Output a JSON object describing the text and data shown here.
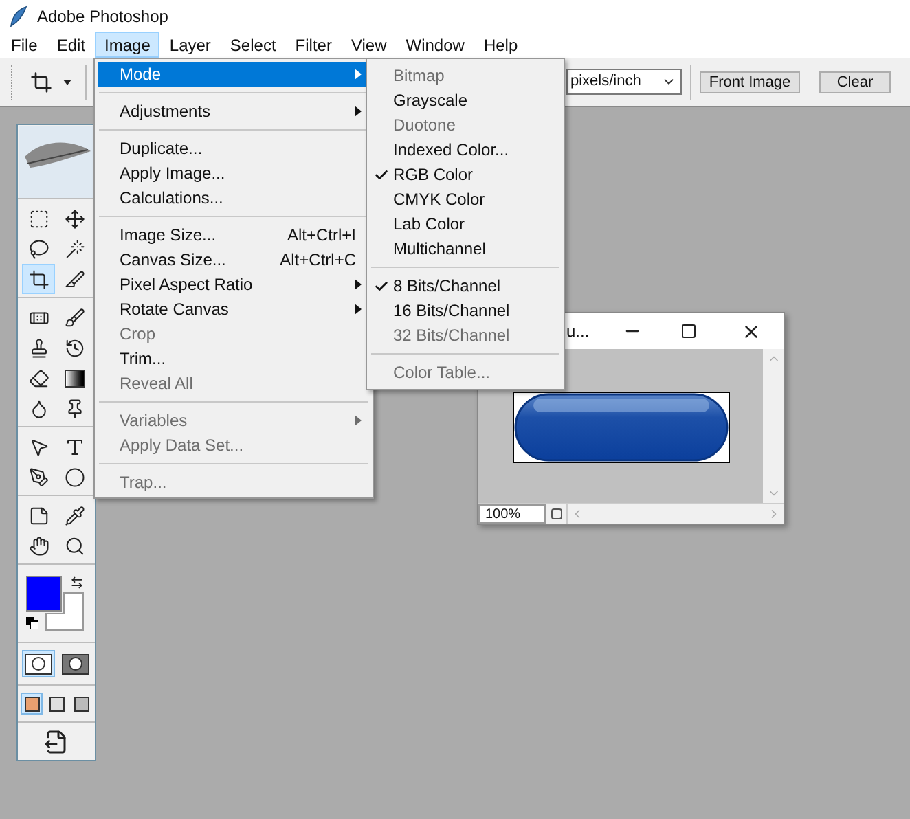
{
  "title_bar": {
    "title": "Adobe Photoshop"
  },
  "menu_bar": [
    {
      "label": "File",
      "selected": false
    },
    {
      "label": "Edit",
      "selected": false
    },
    {
      "label": "Image",
      "selected": true
    },
    {
      "label": "Layer",
      "selected": false
    },
    {
      "label": "Select",
      "selected": false
    },
    {
      "label": "Filter",
      "selected": false
    },
    {
      "label": "View",
      "selected": false
    },
    {
      "label": "Window",
      "selected": false
    },
    {
      "label": "Help",
      "selected": false
    }
  ],
  "options_bar": {
    "resolution_unit": "pixels/inch",
    "buttons": [
      "Front Image",
      "Clear"
    ]
  },
  "toolbox": {
    "tool_groups": [
      [
        {
          "kind": "marquee",
          "selected": false
        },
        {
          "kind": "move",
          "selected": false
        },
        {
          "kind": "lasso",
          "selected": false
        },
        {
          "kind": "wand",
          "selected": false
        },
        {
          "kind": "crop",
          "selected": true
        },
        {
          "kind": "slice",
          "selected": false
        }
      ],
      [
        {
          "kind": "heal",
          "selected": false
        },
        {
          "kind": "brush",
          "selected": false
        },
        {
          "kind": "stamp",
          "selected": false
        },
        {
          "kind": "history",
          "selected": false
        },
        {
          "kind": "eraser",
          "selected": false
        },
        {
          "kind": "gradient",
          "selected": false
        },
        {
          "kind": "blur",
          "selected": false
        },
        {
          "kind": "dodge",
          "selected": false
        }
      ],
      [
        {
          "kind": "path_select",
          "selected": false
        },
        {
          "kind": "type",
          "selected": false
        },
        {
          "kind": "pen",
          "selected": false
        },
        {
          "kind": "ellipse",
          "selected": false
        }
      ],
      [
        {
          "kind": "notes",
          "selected": false
        },
        {
          "kind": "eyedropper",
          "selected": false
        },
        {
          "kind": "hand",
          "selected": false
        },
        {
          "kind": "zoom",
          "selected": false
        }
      ]
    ],
    "foreground": {
      "color": "#0000ff"
    },
    "background": {
      "color": "#ffffff"
    },
    "edit_modes": [
      {
        "kind": "standard",
        "selected": true
      },
      {
        "kind": "quick_mask",
        "selected": false
      }
    ],
    "screen_modes": [
      {
        "kind": "standard",
        "selected": true
      },
      {
        "kind": "full_menu",
        "selected": false
      },
      {
        "kind": "full",
        "selected": false
      }
    ]
  },
  "image_menu": {
    "items": [
      {
        "kind": "item",
        "label": "Mode",
        "submenu": true,
        "disabled": false,
        "selected": true
      },
      {
        "kind": "separator"
      },
      {
        "kind": "item",
        "label": "Adjustments",
        "submenu": true,
        "disabled": false,
        "selected": false
      },
      {
        "kind": "separator"
      },
      {
        "kind": "item",
        "label": "Duplicate...",
        "disabled": false,
        "selected": false
      },
      {
        "kind": "item",
        "label": "Apply Image...",
        "disabled": false,
        "selected": false
      },
      {
        "kind": "item",
        "label": "Calculations...",
        "disabled": false,
        "selected": false
      },
      {
        "kind": "separator"
      },
      {
        "kind": "item",
        "label": "Image Size...",
        "shortcut": "Alt+Ctrl+I",
        "disabled": false,
        "selected": false
      },
      {
        "kind": "item",
        "label": "Canvas Size...",
        "shortcut": "Alt+Ctrl+C",
        "disabled": false,
        "selected": false
      },
      {
        "kind": "item",
        "label": "Pixel Aspect Ratio",
        "submenu": true,
        "disabled": false,
        "selected": false
      },
      {
        "kind": "item",
        "label": "Rotate Canvas",
        "submenu": true,
        "disabled": false,
        "selected": false
      },
      {
        "kind": "item",
        "label": "Crop",
        "disabled": true,
        "selected": false
      },
      {
        "kind": "item",
        "label": "Trim...",
        "disabled": false,
        "selected": false
      },
      {
        "kind": "item",
        "label": "Reveal All",
        "disabled": true,
        "selected": false
      },
      {
        "kind": "separator"
      },
      {
        "kind": "item",
        "label": "Variables",
        "submenu": true,
        "disabled": true,
        "selected": false
      },
      {
        "kind": "item",
        "label": "Apply Data Set...",
        "disabled": true,
        "selected": false
      },
      {
        "kind": "separator"
      },
      {
        "kind": "item",
        "label": "Trap...",
        "disabled": true,
        "selected": false
      }
    ]
  },
  "mode_submenu": {
    "items": [
      {
        "kind": "item",
        "label": "Bitmap",
        "checked": false,
        "disabled": true
      },
      {
        "kind": "item",
        "label": "Grayscale",
        "checked": false,
        "disabled": false
      },
      {
        "kind": "item",
        "label": "Duotone",
        "checked": false,
        "disabled": true
      },
      {
        "kind": "item",
        "label": "Indexed Color...",
        "checked": false,
        "disabled": false
      },
      {
        "kind": "item",
        "label": "RGB Color",
        "checked": true,
        "disabled": false
      },
      {
        "kind": "item",
        "label": "CMYK Color",
        "checked": false,
        "disabled": false
      },
      {
        "kind": "item",
        "label": "Lab Color",
        "checked": false,
        "disabled": false
      },
      {
        "kind": "item",
        "label": "Multichannel",
        "checked": false,
        "disabled": false
      },
      {
        "kind": "separator"
      },
      {
        "kind": "item",
        "label": "8 Bits/Channel",
        "checked": true,
        "disabled": false
      },
      {
        "kind": "item",
        "label": "16 Bits/Channel",
        "checked": false,
        "disabled": false
      },
      {
        "kind": "item",
        "label": "32 Bits/Channel",
        "checked": false,
        "disabled": true
      },
      {
        "kind": "separator"
      },
      {
        "kind": "item",
        "label": "Color Table...",
        "checked": false,
        "disabled": true
      }
    ]
  },
  "document_window": {
    "title": "u...",
    "zoom": "100%"
  }
}
